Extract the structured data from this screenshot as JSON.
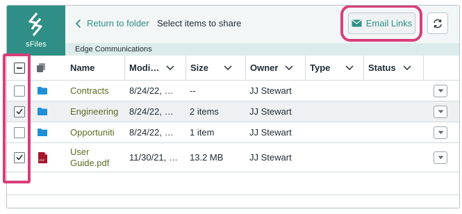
{
  "app": {
    "logo_text": "sFiles"
  },
  "header": {
    "back_label": "Return to folder",
    "title": "Select items to share",
    "email_button_label": "Email Links",
    "breadcrumb": "Edge Communications"
  },
  "table": {
    "headers": {
      "name": "Name",
      "modified": "Modi…",
      "size": "Size",
      "owner": "Owner",
      "type": "Type",
      "status": "Status"
    },
    "header_checkbox_state": "indeterminate",
    "rows": [
      {
        "name": "Contracts",
        "modified": "8/24/22, …",
        "size": "--",
        "owner": "JJ Stewart",
        "type": "",
        "status": "",
        "icon": "folder-icon",
        "checked": false
      },
      {
        "name": "Engineering",
        "modified": "8/24/22, …",
        "size": "2 items",
        "owner": "JJ Stewart",
        "type": "",
        "status": "",
        "icon": "folder-icon",
        "checked": true
      },
      {
        "name": "Opportuniti",
        "modified": "8/24/22, …",
        "size": "1 item",
        "owner": "JJ Stewart",
        "type": "",
        "status": "",
        "icon": "folder-icon",
        "checked": false
      },
      {
        "name_line1": "User",
        "name_line2": "Guide.pdf",
        "modified": "11/30/21, …",
        "size": "13.2 MB",
        "owner": "JJ Stewart",
        "type": "",
        "status": "",
        "icon": "pdf-icon",
        "icon_label": "PDF",
        "checked": true
      }
    ]
  },
  "colors": {
    "brand": "#2f8f86",
    "highlight": "#d83f78",
    "folder": "#1e90d6",
    "pdf": "#a3172d",
    "name_link": "#5b6b22"
  }
}
